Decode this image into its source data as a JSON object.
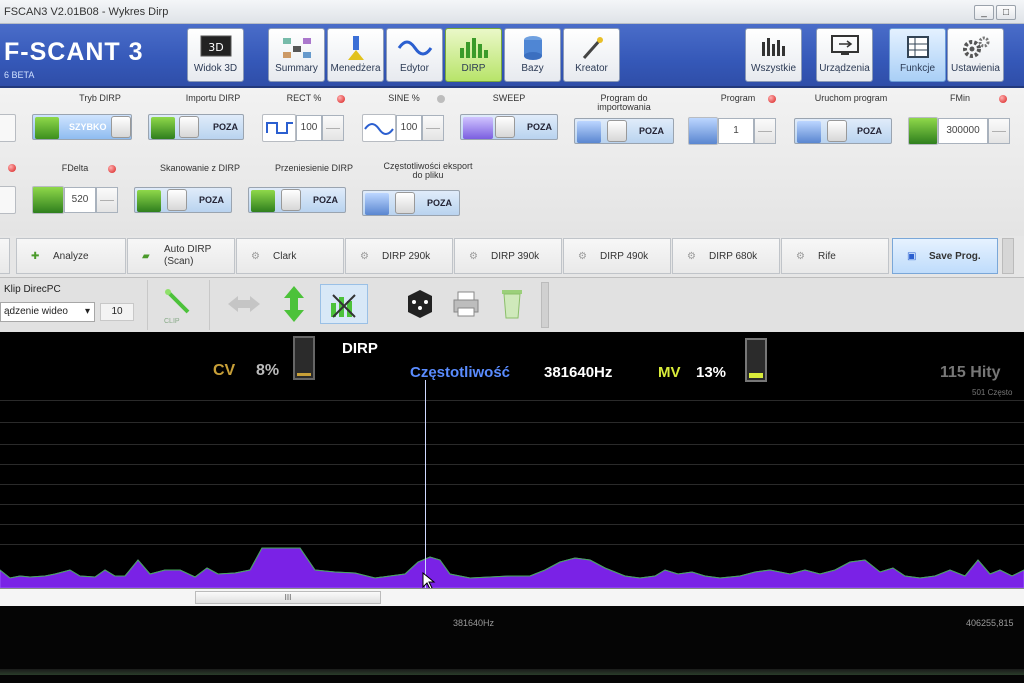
{
  "window": {
    "title": "FSCAN3 V2.01B08 - Wykres Dirp",
    "minimize": "_",
    "restore": "□"
  },
  "brand": {
    "name": "F-SCANT 3",
    "subtitle": "6 BETA"
  },
  "nav": [
    {
      "label": "Widok 3D",
      "icon": "3d-view-icon"
    },
    {
      "label": "Summary",
      "icon": "summary-icon"
    },
    {
      "label": "Menedżera",
      "icon": "manager-icon"
    },
    {
      "label": "Edytor",
      "icon": "editor-wave-icon"
    },
    {
      "label": "DIRP",
      "icon": "dirp-chart-icon",
      "active": true
    },
    {
      "label": "Bazy",
      "icon": "database-icon"
    },
    {
      "label": "Kreator",
      "icon": "wizard-icon"
    }
  ],
  "nav_right": [
    {
      "label": "Wszystkie",
      "icon": "bars-icon"
    },
    {
      "label": "Urządzenia",
      "icon": "device-icon"
    },
    {
      "label": "Funkcje",
      "icon": "functions-icon",
      "active": true
    },
    {
      "label": "Ustawienia",
      "icon": "gear-icon"
    }
  ],
  "params": {
    "tryb_dirp": {
      "label": "Tryb DIRP",
      "value": "SZYBKO"
    },
    "importu_dirp": {
      "label": "Importu DIRP",
      "value": "POZA"
    },
    "rect": {
      "label": "RECT %",
      "value": "100"
    },
    "sine": {
      "label": "SINE %",
      "value": "100"
    },
    "sweep": {
      "label": "SWEEP",
      "value": "POZA"
    },
    "program_import": {
      "label": "Program do importowania",
      "value": "POZA"
    },
    "program": {
      "label": "Program",
      "value": "1"
    },
    "uruchom": {
      "label": "Uruchom program",
      "value": "POZA"
    },
    "fmin": {
      "label": "FMin",
      "value": "300000"
    },
    "fdelta": {
      "label": "FDelta",
      "value": "520"
    },
    "skan": {
      "label": "Skanowanie z DIRP",
      "value": "POZA"
    },
    "przeniesienie": {
      "label": "Przeniesienie DIRP",
      "value": "POZA"
    },
    "eksport": {
      "label": "Częstotliwości eksport do pliku",
      "value": "POZA"
    }
  },
  "presets": [
    "Analyze",
    "Auto DIRP (Scan)",
    "Clark",
    "DIRP 290k",
    "DIRP 390k",
    "DIRP 490k",
    "DIRP 680k",
    "Rife",
    "Save Prog."
  ],
  "toolbar": {
    "clip_title": "Klip DirecPC",
    "device_select": "ądzenie wideo",
    "count": "10",
    "clip_label": "CLIP"
  },
  "graph": {
    "title": "DIRP",
    "cv_label": "CV",
    "cv_value": "8%",
    "freq_label": "Częstotliwość",
    "freq_value": "381640Hz",
    "mv_label": "MV",
    "mv_value": "13%",
    "hits": "115 Hity",
    "hits_sub": "501 Często",
    "cv_level": 0.08,
    "mv_level": 0.13,
    "colors": {
      "cv": "#c8a038",
      "freq": "#5a8cff",
      "mv": "#d9ec3a",
      "spectrum": "#7a22e6",
      "peak": "#2fbf2f"
    }
  },
  "axis": {
    "cursor_label": "381640Hz",
    "end_label": "406255,815"
  },
  "scrollbar": {
    "thumb": "III"
  }
}
